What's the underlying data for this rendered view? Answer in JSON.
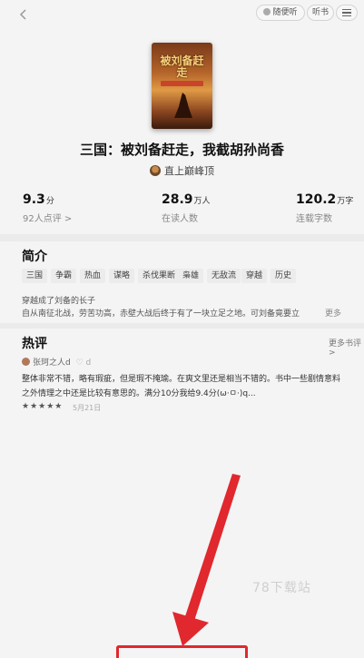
{
  "topbar": {
    "listen_label": "随便听",
    "ting_label": "听书"
  },
  "book": {
    "title": "三国：被刘备赶走，我截胡孙尚香",
    "author": "直上巅峰顶",
    "cover_title": "被刘备赶走"
  },
  "stats": [
    {
      "value": "9.3",
      "unit": "分",
      "label": "92人点评 >"
    },
    {
      "value": "28.9",
      "unit": "万人",
      "label": "在读人数"
    },
    {
      "value": "120.2",
      "unit": "万字",
      "label": "连载字数"
    }
  ],
  "intro": {
    "heading": "简介",
    "tags": [
      "三国",
      "争霸",
      "热血",
      "谋略",
      "杀伐果断",
      "枭雄",
      "无敌流",
      "穿越",
      "历史"
    ],
    "line1": "穿越成了刘备的长子",
    "line2": "自从南征北战，劳苦功高，赤壁大战后终于有了一块立足之地。可刘备竟要立",
    "more": "更多"
  },
  "reviews": {
    "heading": "热评",
    "more_label": "更多书评 >",
    "user": "张珂之人d",
    "like": "♡ d",
    "line1": "整体非常不错，略有瑕疵，但是瑕不掩瑜。在爽文里还是相当不错的。书中一些剧情意料",
    "line2": "之外情理之中还是比较有意思的。满分10分我给9.4分(ω·ㅁ·)q...",
    "stars": "★★★★★",
    "date": "5月21日"
  },
  "watermark": "78下载站"
}
